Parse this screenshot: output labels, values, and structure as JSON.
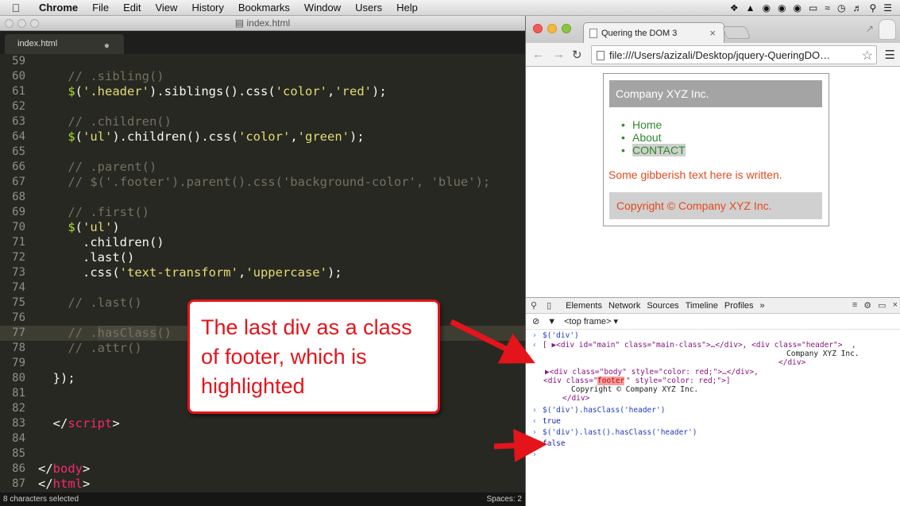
{
  "menubar": {
    "items": [
      "Chrome",
      "File",
      "Edit",
      "View",
      "History",
      "Bookmarks",
      "Window",
      "Users",
      "Help"
    ]
  },
  "editor": {
    "window_title": "index.html",
    "tab_label": "index.html",
    "lines": [
      {
        "n": "59",
        "tokens": []
      },
      {
        "n": "60",
        "tokens": [
          {
            "c": "t-cm",
            "t": "    // .sibling()"
          }
        ]
      },
      {
        "n": "61",
        "tokens": [
          {
            "c": "t-fn",
            "t": "    $"
          },
          {
            "c": "t-pl",
            "t": "("
          },
          {
            "c": "t-st",
            "t": "'.header'"
          },
          {
            "c": "t-pl",
            "t": ").siblings().css("
          },
          {
            "c": "t-st",
            "t": "'color'"
          },
          {
            "c": "t-pl",
            "t": ","
          },
          {
            "c": "t-st",
            "t": "'red'"
          },
          {
            "c": "t-pl",
            "t": ");"
          }
        ]
      },
      {
        "n": "62",
        "tokens": []
      },
      {
        "n": "63",
        "tokens": [
          {
            "c": "t-cm",
            "t": "    // .children()"
          }
        ]
      },
      {
        "n": "64",
        "tokens": [
          {
            "c": "t-fn",
            "t": "    $"
          },
          {
            "c": "t-pl",
            "t": "("
          },
          {
            "c": "t-st",
            "t": "'ul'"
          },
          {
            "c": "t-pl",
            "t": ").children().css("
          },
          {
            "c": "t-st",
            "t": "'color'"
          },
          {
            "c": "t-pl",
            "t": ","
          },
          {
            "c": "t-st",
            "t": "'green'"
          },
          {
            "c": "t-pl",
            "t": ");"
          }
        ]
      },
      {
        "n": "65",
        "tokens": []
      },
      {
        "n": "66",
        "tokens": [
          {
            "c": "t-cm",
            "t": "    // .parent()"
          }
        ]
      },
      {
        "n": "67",
        "tokens": [
          {
            "c": "t-cm",
            "t": "    // $('.footer').parent().css('background-color', 'blue');"
          }
        ]
      },
      {
        "n": "68",
        "tokens": []
      },
      {
        "n": "69",
        "tokens": [
          {
            "c": "t-cm",
            "t": "    // .first()"
          }
        ]
      },
      {
        "n": "70",
        "tokens": [
          {
            "c": "t-fn",
            "t": "    $"
          },
          {
            "c": "t-pl",
            "t": "("
          },
          {
            "c": "t-st",
            "t": "'ul'"
          },
          {
            "c": "t-pl",
            "t": ")"
          }
        ]
      },
      {
        "n": "71",
        "tokens": [
          {
            "c": "t-pl",
            "t": "      .children()"
          }
        ]
      },
      {
        "n": "72",
        "tokens": [
          {
            "c": "t-pl",
            "t": "      .last()"
          }
        ]
      },
      {
        "n": "73",
        "tokens": [
          {
            "c": "t-pl",
            "t": "      .css("
          },
          {
            "c": "t-st",
            "t": "'text-transform'"
          },
          {
            "c": "t-pl",
            "t": ","
          },
          {
            "c": "t-st",
            "t": "'uppercase'"
          },
          {
            "c": "t-pl",
            "t": ");"
          }
        ]
      },
      {
        "n": "74",
        "tokens": []
      },
      {
        "n": "75",
        "tokens": [
          {
            "c": "t-cm",
            "t": "    // .last()"
          }
        ]
      },
      {
        "n": "76",
        "tokens": []
      },
      {
        "n": "77",
        "tokens": [
          {
            "c": "t-cm",
            "t": "    // ."
          },
          {
            "c": "t-cm t-sel",
            "t": "hasClass"
          },
          {
            "c": "t-cm",
            "t": "()"
          }
        ]
      },
      {
        "n": "78",
        "tokens": [
          {
            "c": "t-cm",
            "t": "    // .attr()"
          }
        ]
      },
      {
        "n": "79",
        "tokens": []
      },
      {
        "n": "80",
        "tokens": [
          {
            "c": "t-pl",
            "t": "  });"
          }
        ]
      },
      {
        "n": "81",
        "tokens": []
      },
      {
        "n": "82",
        "tokens": []
      },
      {
        "n": "83",
        "tokens": [
          {
            "c": "t-pl",
            "t": "  </"
          },
          {
            "c": "t-kw",
            "t": "script"
          },
          {
            "c": "t-pl",
            "t": ">"
          }
        ]
      },
      {
        "n": "84",
        "tokens": []
      },
      {
        "n": "85",
        "tokens": []
      },
      {
        "n": "86",
        "tokens": [
          {
            "c": "t-pl",
            "t": "</"
          },
          {
            "c": "t-kw",
            "t": "body"
          },
          {
            "c": "t-pl",
            "t": ">"
          }
        ]
      },
      {
        "n": "87",
        "tokens": [
          {
            "c": "t-pl",
            "t": "</"
          },
          {
            "c": "t-kw",
            "t": "html"
          },
          {
            "c": "t-pl",
            "t": ">"
          }
        ]
      }
    ],
    "highlighted_line": "77",
    "status_left": "8 characters selected",
    "status_right": "Spaces: 2"
  },
  "callout": {
    "text": "The last div as a class of footer, which is highlighted",
    "color": "#e4141b"
  },
  "browser": {
    "tab_title": "Quering the DOM 3",
    "url": "file:///Users/azizali/Desktop/jquery-QueringDO…",
    "page": {
      "header": "Company XYZ Inc.",
      "list": [
        "Home",
        "About",
        "CONTACT"
      ],
      "body_text": "Some gibberish text here is written.",
      "footer": "Copyright © Company XYZ Inc."
    },
    "devtools": {
      "tabs": [
        "Elements",
        "Network",
        "Sources",
        "Timeline",
        "Profiles"
      ],
      "frame": "<top frame>",
      "console": [
        {
          "type": "in",
          "text": "$('div')"
        },
        {
          "type": "out1",
          "text": "[ ▶<div id=\"main\" class=\"main-class\">…</div>, <div class=\"header\">  ,"
        },
        {
          "type": "txt",
          "text": "Company XYZ Inc."
        },
        {
          "type": "txt",
          "text": "</div>"
        },
        {
          "type": "out2",
          "text": "▶<div class=\"body\" style=\"color: red;\">…</div>,"
        },
        {
          "type": "out3a",
          "text": "<div class=\""
        },
        {
          "type": "out3b",
          "text": "footer"
        },
        {
          "type": "out3c",
          "text": "\" style=\"color: red;\">]"
        },
        {
          "type": "txt",
          "text": "Copyright © Company XYZ Inc."
        },
        {
          "type": "txt",
          "text": "</div>"
        },
        {
          "type": "in",
          "text": "$('div').hasClass('header')"
        },
        {
          "type": "res",
          "text": "true"
        },
        {
          "type": "in",
          "text": "$('div').last().hasClass('header')"
        },
        {
          "type": "res",
          "text": "false"
        }
      ]
    }
  }
}
